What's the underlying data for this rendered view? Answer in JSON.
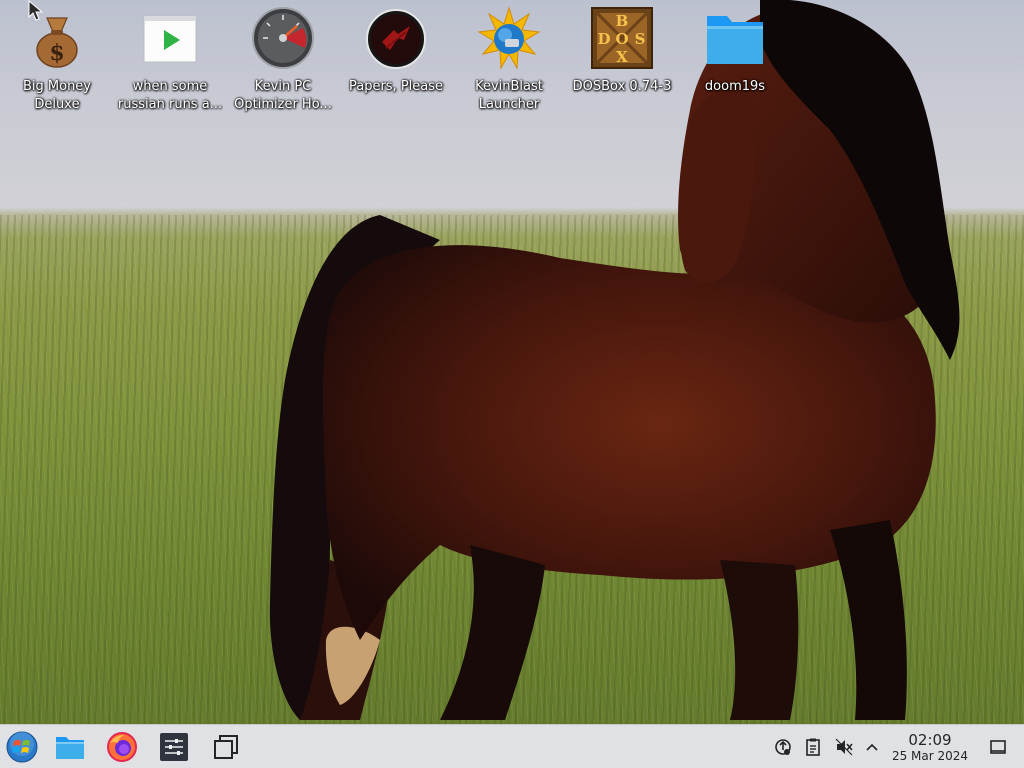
{
  "desktop": {
    "icons": [
      {
        "label": "Big Money Deluxe",
        "icon": "money-bag-icon"
      },
      {
        "label": "when some russian runs a...",
        "icon": "video-play-icon"
      },
      {
        "label": "Kevin PC Optimizer Ho...",
        "icon": "speedometer-icon"
      },
      {
        "label": "Papers, Please",
        "icon": "papers-please-emblem-icon"
      },
      {
        "label": "KevinBlast Launcher",
        "icon": "sun-globe-icon"
      },
      {
        "label": "DOSBox 0.74-3",
        "icon": "dosbox-icon"
      },
      {
        "label": "doom19s",
        "icon": "folder-icon"
      }
    ]
  },
  "taskbar": {
    "launcher": "start-menu-icon",
    "pinned": [
      "file-manager-icon",
      "firefox-icon",
      "settings-sliders-icon",
      "window-overview-icon"
    ],
    "tray": [
      "network-icon",
      "clipboard-icon",
      "volume-muted-icon",
      "chevron-up-icon"
    ],
    "clock": {
      "time": "02:09",
      "date": "25 Mar 2024"
    },
    "show_desktop": "show-desktop-icon"
  },
  "colors": {
    "taskbar": "#dfe1e5",
    "folder_accent": "#3daee9",
    "label_text": "#ffffff"
  }
}
